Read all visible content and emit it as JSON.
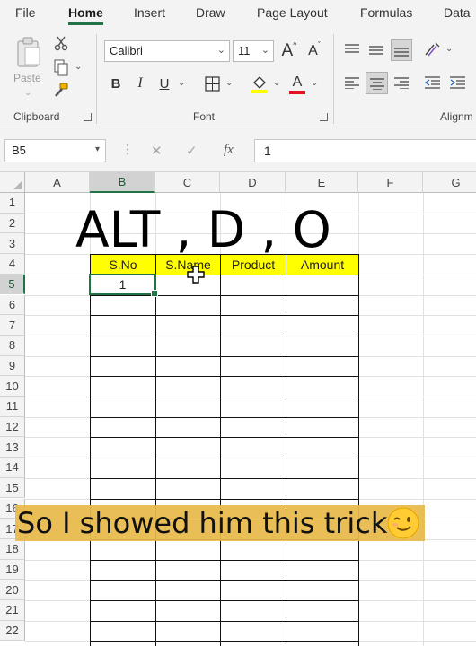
{
  "menu": {
    "tabs": [
      "File",
      "Home",
      "Insert",
      "Draw",
      "Page Layout",
      "Formulas",
      "Data"
    ],
    "active": "Home"
  },
  "ribbon": {
    "clipboard": {
      "paste_label": "Paste",
      "group_label": "Clipboard"
    },
    "font": {
      "font_name": "Calibri",
      "font_size": "11",
      "group_label": "Font",
      "bold": "B",
      "italic": "I",
      "underline": "U",
      "grow_label": "A",
      "shrink_label": "A",
      "font_color_label": "A",
      "font_color": "#e81123",
      "fill_color": "#ffff00"
    },
    "alignment": {
      "group_label": "Alignm"
    }
  },
  "formula_bar": {
    "name_box": "B5",
    "fx_label": "fx",
    "content": "1"
  },
  "grid": {
    "columns": [
      "A",
      "B",
      "C",
      "D",
      "E",
      "F",
      "G"
    ],
    "rows": [
      "1",
      "2",
      "3",
      "4",
      "5",
      "6",
      "7",
      "8",
      "9",
      "10",
      "11",
      "12",
      "13",
      "14",
      "15",
      "16",
      "17",
      "18",
      "19",
      "20",
      "21",
      "22"
    ],
    "selected_column": "B",
    "selected_row": "5",
    "table_headers": [
      "S.No",
      "S.Name",
      "Product",
      "Amount"
    ],
    "header_fill": "#ffff00",
    "row5_b": "1",
    "accent": "#217346"
  },
  "overlay": {
    "shortcut_text": "ALT , D , O",
    "caption": "So I showed him this trick"
  }
}
